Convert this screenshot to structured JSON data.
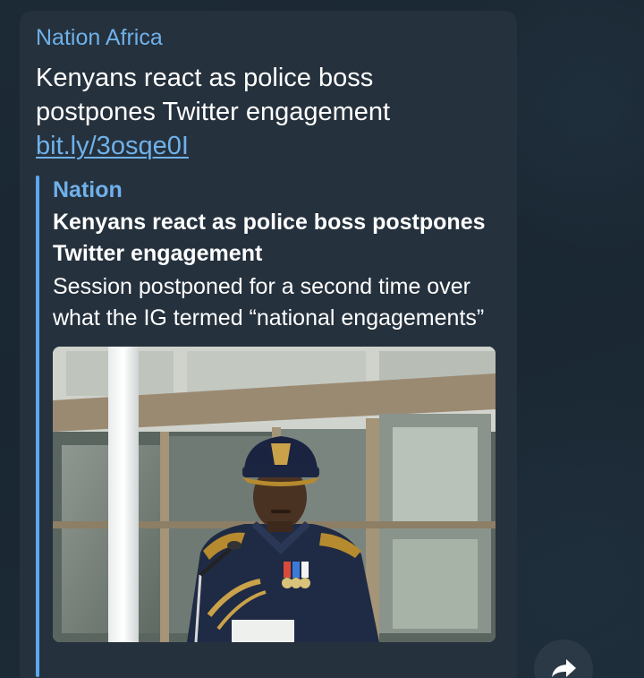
{
  "message": {
    "sender": "Nation Africa",
    "text": "Kenyans react as police boss postpones Twitter engagement",
    "link": "bit.ly/3osqe0I"
  },
  "link_preview": {
    "site_name": "Nation",
    "title": "Kenyans react as police boss postpones Twitter engagement",
    "description": "Session postponed for a second time over what the IG termed “national engagements”",
    "image_icon": "photo-of-police-inspector-general"
  },
  "actions": {
    "share_icon": "share-arrow-icon"
  },
  "colors": {
    "chat_background": "#1c2a35",
    "bubble": "#25313d",
    "accent": "#6fb1ea",
    "preview_bar": "#5aa9ec",
    "text": "#ffffff"
  }
}
